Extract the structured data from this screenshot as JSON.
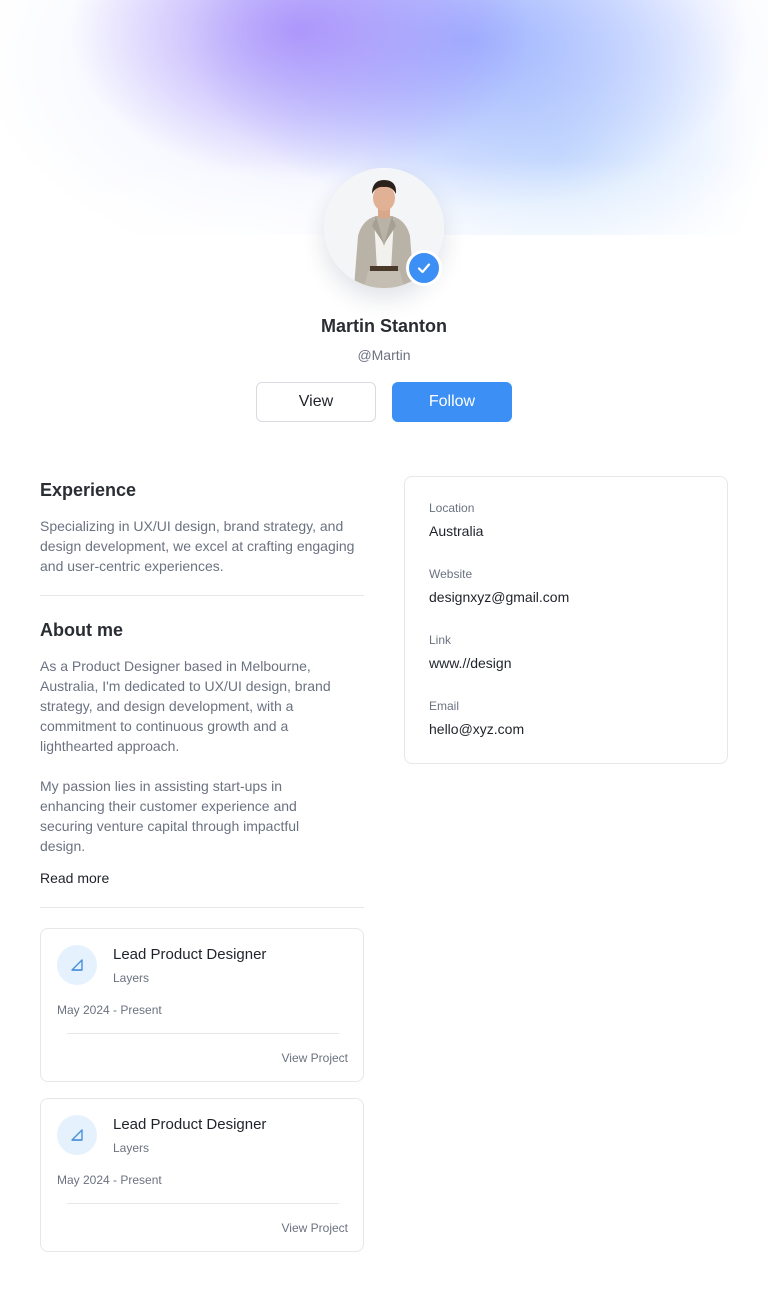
{
  "profile": {
    "name": "Martin Stanton",
    "handle": "@Martin",
    "verified": true,
    "avatar_icon": "person-portrait",
    "verified_icon": "check-badge-icon"
  },
  "actions": {
    "view_label": "View",
    "follow_label": "Follow"
  },
  "colors": {
    "accent": "#3b8ff5",
    "muted_text": "#6b7280",
    "border": "#e5e7eb"
  },
  "experience": {
    "title": "Experience",
    "text": "Specializing in UX/UI design, brand strategy, and design development, we excel at crafting engaging and user-centric experiences."
  },
  "about": {
    "title": "About me",
    "paragraph_1": "As a Product Designer based in Melbourne, Australia, I'm dedicated to UX/UI design, brand strategy, and design development, with a commitment to continuous growth and a lighthearted approach.",
    "paragraph_2": "My passion lies in assisting start-ups in enhancing their customer experience and securing venture capital through impactful design.",
    "read_more_label": "Read more"
  },
  "info": [
    {
      "label": "Location",
      "value": "Australia"
    },
    {
      "label": "Website",
      "value": "designxyz@gmail.com"
    },
    {
      "label": "Link",
      "value": "www.//design"
    },
    {
      "label": "Email",
      "value": "hello@xyz.com"
    }
  ],
  "projects": [
    {
      "title": "Lead Product Designer",
      "company": "Layers",
      "dates": "May 2024 - Present",
      "link_label": "View Project",
      "icon": "layers-triangle-icon"
    },
    {
      "title": "Lead Product Designer",
      "company": "Layers",
      "dates": "May 2024 - Present",
      "link_label": "View Project",
      "icon": "layers-triangle-icon"
    }
  ]
}
